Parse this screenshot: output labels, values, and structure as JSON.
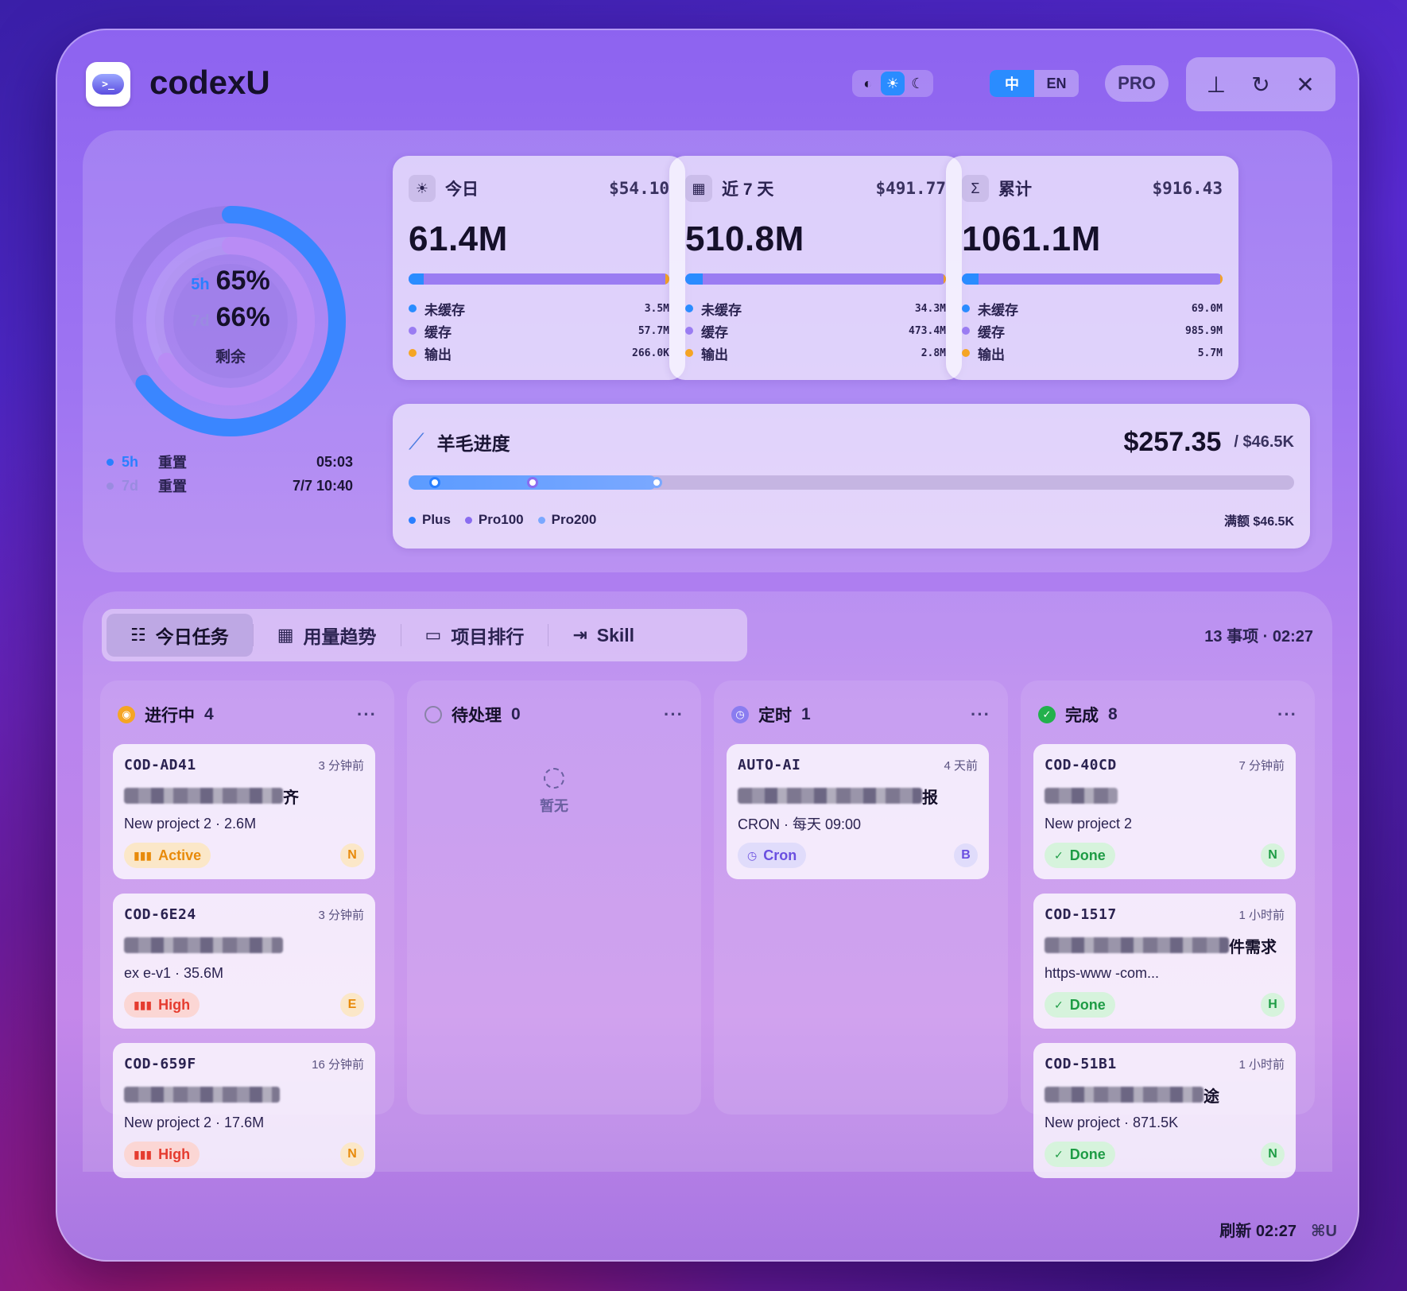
{
  "app": {
    "title": "codexU",
    "logo_text": ">_"
  },
  "header": {
    "theme_options": [
      "◐",
      "☀",
      "☾"
    ],
    "languages": [
      "中",
      "EN"
    ],
    "pro_label": "PRO",
    "controls": [
      "pin",
      "refresh",
      "close"
    ]
  },
  "gauge": {
    "five_hour": {
      "tag": "5h",
      "percent": 65,
      "label": "65%"
    },
    "seven_day": {
      "tag": "7d",
      "percent": 66,
      "label": "66%"
    },
    "remain_label": "剩余",
    "colors": {
      "outer": "#3a86ff",
      "inner": "#b98cf5"
    }
  },
  "resets": [
    {
      "tag": "5h",
      "label": "重置",
      "time": "05:03",
      "color": "#2a7fff"
    },
    {
      "tag": "7d",
      "label": "重置",
      "time": "7/7 10:40",
      "color": "#9a8be0"
    }
  ],
  "stats": [
    {
      "icon": "☀",
      "icon_name": "sun-icon",
      "label": "今日",
      "cost": "$54.10",
      "tokens": "61.4M",
      "legend": [
        {
          "label": "未缓存",
          "value": "3.5M",
          "color": "#2a8cff"
        },
        {
          "label": "缓存",
          "value": "57.7M",
          "color": "#9a7cf2"
        },
        {
          "label": "输出",
          "value": "266.0K",
          "color": "#f5a524"
        }
      ]
    },
    {
      "icon": "▦",
      "icon_name": "calendar-icon",
      "label": "近 7 天",
      "cost": "$491.77",
      "tokens": "510.8M",
      "legend": [
        {
          "label": "未缓存",
          "value": "34.3M",
          "color": "#2a8cff"
        },
        {
          "label": "缓存",
          "value": "473.4M",
          "color": "#9a7cf2"
        },
        {
          "label": "输出",
          "value": "2.8M",
          "color": "#f5a524"
        }
      ]
    },
    {
      "icon": "Σ",
      "icon_name": "sigma-icon",
      "label": "累计",
      "cost": "$916.43",
      "tokens": "1061.1M",
      "legend": [
        {
          "label": "未缓存",
          "value": "69.0M",
          "color": "#2a8cff"
        },
        {
          "label": "缓存",
          "value": "985.9M",
          "color": "#9a7cf2"
        },
        {
          "label": "输出",
          "value": "5.7M",
          "color": "#f5a524"
        }
      ]
    }
  ],
  "progress": {
    "title": "羊毛进度",
    "amount": "$257.35",
    "total": "/ $46.5K",
    "fill_fraction": 0.28,
    "legend": [
      {
        "label": "Plus",
        "color": "#2a7fff"
      },
      {
        "label": "Pro100",
        "color": "#8a6cf0"
      },
      {
        "label": "Pro200",
        "color": "#7aa8ff"
      }
    ],
    "cap_label": "满额 $46.5K"
  },
  "tabs": [
    {
      "label": "今日任务",
      "icon": "☷",
      "name": "tab-today-tasks",
      "active": true
    },
    {
      "label": "用量趋势",
      "icon": "▦",
      "name": "tab-usage-trend",
      "active": false
    },
    {
      "label": "项目排行",
      "icon": "▭",
      "name": "tab-project-ranking",
      "active": false
    },
    {
      "label": "Skill",
      "icon": "⇥",
      "name": "tab-skill",
      "active": false
    }
  ],
  "tasks_meta": "13 事项 · 02:27",
  "columns": [
    {
      "title": "进行中",
      "count": "4",
      "icon_color": "#f5a524",
      "icon": "◉",
      "more": "···",
      "tasks": [
        {
          "id": "COD-AD41",
          "time": "3 分钟前",
          "title_end": "齐",
          "sub": "New project 2 · 2.6M",
          "status": "Active",
          "status_class": "active",
          "status_icon": "▮▮▮",
          "avatar": "N",
          "avatar_class": "orange"
        },
        {
          "id": "COD-6E24",
          "time": "3 分钟前",
          "title_end": "",
          "sub": "ex                e-v1 · 35.6M",
          "status": "High",
          "status_class": "high",
          "status_icon": "▮▮▮",
          "avatar": "E",
          "avatar_class": "orange"
        },
        {
          "id": "COD-659F",
          "time": "16 分钟前",
          "title_end": "",
          "sub": "New project 2 · 17.6M",
          "status": "High",
          "status_class": "high",
          "status_icon": "▮▮▮",
          "avatar": "N",
          "avatar_class": "orange"
        }
      ]
    },
    {
      "title": "待处理",
      "count": "0",
      "icon_color": "#8a82a8",
      "icon": "○",
      "more": "···",
      "empty": "暂无",
      "tasks": []
    },
    {
      "title": "定时",
      "count": "1",
      "icon_color": "#8a7cf0",
      "icon": "◷",
      "more": "···",
      "tasks": [
        {
          "id": "AUTO-AI",
          "time": "4 天前",
          "title_end": "报",
          "sub": "CRON · 每天 09:00",
          "status": "Cron",
          "status_class": "cron",
          "status_icon": "◷",
          "avatar": "B",
          "avatar_class": "violet"
        }
      ]
    },
    {
      "title": "完成",
      "count": "8",
      "icon_color": "#22b14c",
      "icon": "✓",
      "more": "···",
      "tasks": [
        {
          "id": "COD-40CD",
          "time": "7 分钟前",
          "title_end": "",
          "sub": "New project 2",
          "status": "Done",
          "status_class": "done",
          "status_icon": "✓",
          "avatar": "N",
          "avatar_class": "green"
        },
        {
          "id": "COD-1517",
          "time": "1 小时前",
          "title_end": "件需求",
          "sub": "https-www                -com...",
          "status": "Done",
          "status_class": "done",
          "status_icon": "✓",
          "avatar": "H",
          "avatar_class": "green"
        },
        {
          "id": "COD-51B1",
          "time": "1 小时前",
          "title_end": "途",
          "sub": "New project · 871.5K",
          "status": "Done",
          "status_class": "done",
          "status_icon": "✓",
          "avatar": "N",
          "avatar_class": "green"
        }
      ]
    }
  ],
  "footer": {
    "refresh": "刷新 02:27",
    "shortcut": "⌘U"
  }
}
